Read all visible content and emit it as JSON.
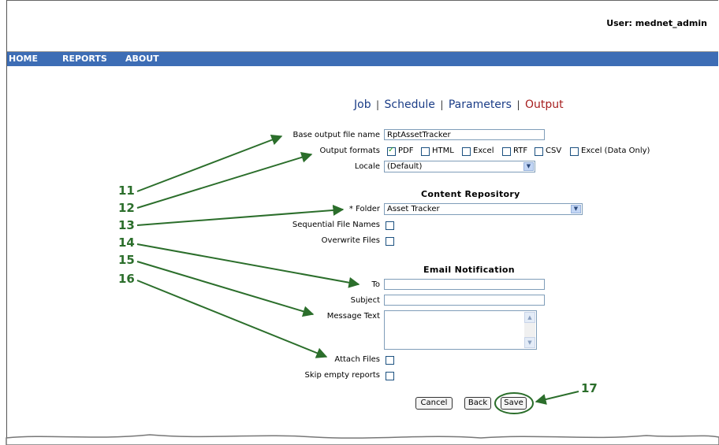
{
  "header": {
    "user_label": "User: mednet_admin"
  },
  "nav": {
    "items": [
      "HOME",
      "REPORTS",
      "ABOUT"
    ]
  },
  "steps": {
    "job": "Job",
    "schedule": "Schedule",
    "parameters": "Parameters",
    "output": "Output",
    "separator": "|"
  },
  "form": {
    "base_name_label": "Base output file name",
    "base_name_value": "RptAssetTracker",
    "formats_label": "Output formats",
    "formats": [
      {
        "label": "PDF",
        "checked": true
      },
      {
        "label": "HTML",
        "checked": false
      },
      {
        "label": "Excel",
        "checked": false
      },
      {
        "label": "RTF",
        "checked": false
      },
      {
        "label": "CSV",
        "checked": false
      },
      {
        "label": "Excel (Data Only)",
        "checked": false
      }
    ],
    "locale_label": "Locale",
    "locale_value": "(Default)",
    "content_repo_title": "Content Repository",
    "folder_label": "* Folder",
    "folder_value": "Asset Tracker",
    "sequential_label": "Sequential File Names",
    "overwrite_label": "Overwrite Files",
    "email_title": "Email Notification",
    "to_label": "To",
    "subject_label": "Subject",
    "message_label": "Message Text",
    "attach_label": "Attach Files",
    "skip_label": "Skip empty reports"
  },
  "buttons": {
    "cancel": "Cancel",
    "back": "Back",
    "save": "Save"
  },
  "callouts": [
    "11",
    "12",
    "13",
    "14",
    "15",
    "16",
    "17"
  ],
  "colors": {
    "nav": "#3d6db5",
    "step_link": "#1b3d87",
    "step_current": "#a61e1e",
    "callout": "#2b6e2b"
  }
}
